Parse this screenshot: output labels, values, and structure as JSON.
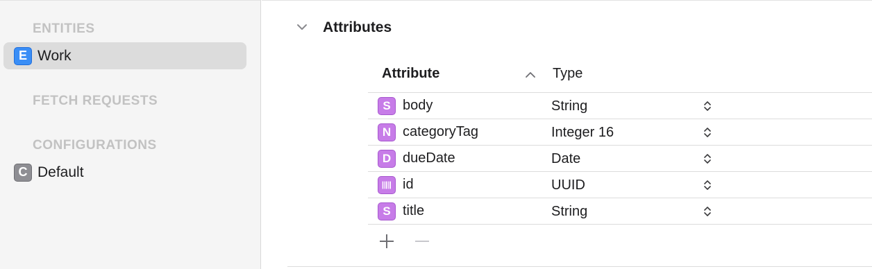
{
  "sidebar": {
    "entities_header": "ENTITIES",
    "entities": [
      {
        "badge": "E",
        "label": "Work",
        "selected": true
      }
    ],
    "fetch_requests_header": "FETCH REQUESTS",
    "configurations_header": "CONFIGURATIONS",
    "configurations": [
      {
        "badge": "C",
        "label": "Default"
      }
    ]
  },
  "main": {
    "section_title": "Attributes",
    "columns": {
      "attribute": "Attribute",
      "type": "Type"
    },
    "rows": [
      {
        "badge": "S",
        "badge_icon": "string-type-icon",
        "name": "body",
        "type": "String"
      },
      {
        "badge": "N",
        "badge_icon": "number-type-icon",
        "name": "categoryTag",
        "type": "Integer 16"
      },
      {
        "badge": "D",
        "badge_icon": "date-type-icon",
        "name": "dueDate",
        "type": "Date"
      },
      {
        "badge": "",
        "badge_icon": "uuid-barcode-icon",
        "name": "id",
        "type": "UUID"
      },
      {
        "badge": "S",
        "badge_icon": "string-type-icon",
        "name": "title",
        "type": "String"
      }
    ]
  },
  "colors": {
    "entity_badge": "#3a8ef6",
    "config_badge": "#8e8e93",
    "attribute_badge": "#c77ce8",
    "selected_row": "#dcdcdc",
    "section_header": "#c2c2c2"
  }
}
